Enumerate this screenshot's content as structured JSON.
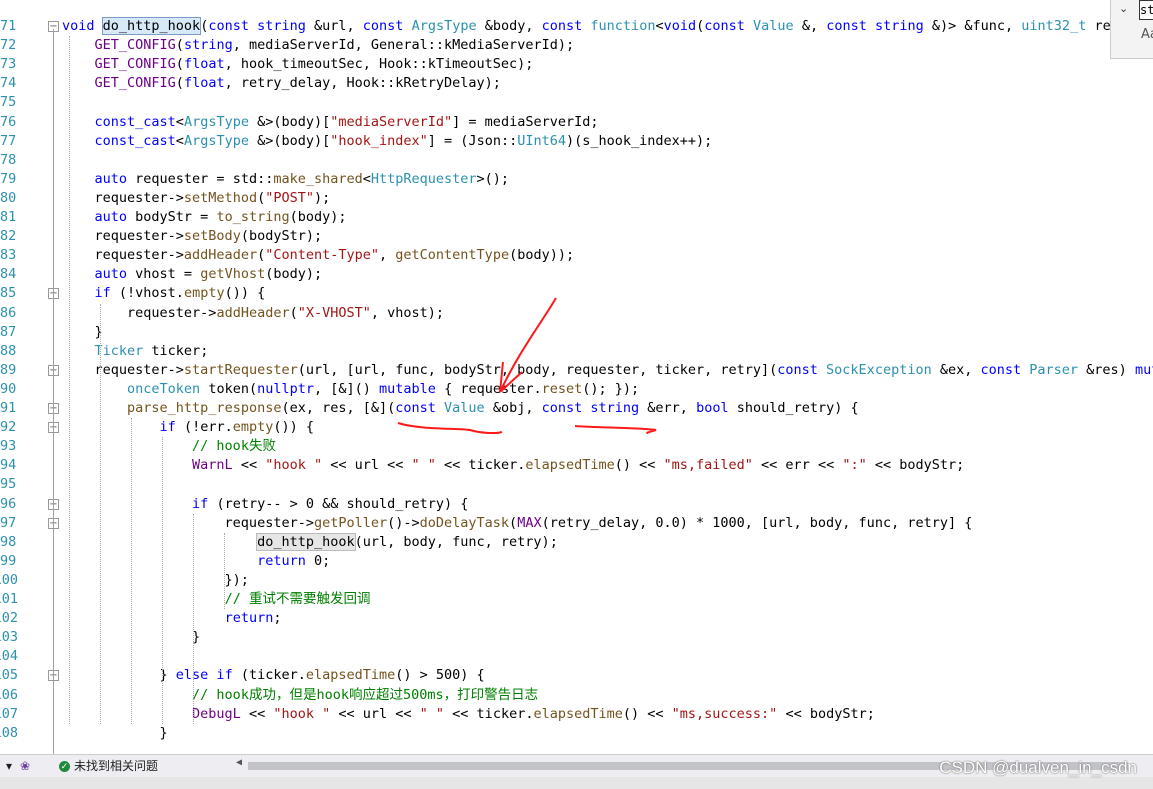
{
  "find": {
    "chevron": "⌄",
    "value": "st",
    "match_case": "Aa"
  },
  "lines": [
    {
      "n": "71",
      "fold": "minus",
      "segs": [
        [
          "kw",
          "void "
        ],
        [
          "hl",
          "do_http_hook"
        ],
        [
          "",
          "("
        ],
        [
          "kw",
          "const "
        ],
        [
          "kw",
          "string "
        ],
        [
          "",
          "&url, "
        ],
        [
          "kw",
          "const "
        ],
        [
          "ty",
          "ArgsType "
        ],
        [
          "",
          "&body, "
        ],
        [
          "kw",
          "const "
        ],
        [
          "ty",
          "function"
        ],
        [
          "",
          "<"
        ],
        [
          "kw",
          "void"
        ],
        [
          "",
          "("
        ],
        [
          "kw",
          "const "
        ],
        [
          "ty",
          "Value "
        ],
        [
          "",
          "&, "
        ],
        [
          "kw",
          "const "
        ],
        [
          "kw",
          "string "
        ],
        [
          "",
          "&)> &func, "
        ],
        [
          "ty",
          "uint32_t "
        ],
        [
          "",
          "retry)"
        ]
      ]
    },
    {
      "n": "72",
      "segs": [
        [
          "",
          "    "
        ],
        [
          "mc",
          "GET_CONFIG"
        ],
        [
          "",
          "("
        ],
        [
          "kw",
          "string"
        ],
        [
          "",
          ", mediaServerId, General::kMediaServerId);"
        ]
      ]
    },
    {
      "n": "73",
      "segs": [
        [
          "",
          "    "
        ],
        [
          "mc",
          "GET_CONFIG"
        ],
        [
          "",
          "("
        ],
        [
          "kw",
          "float"
        ],
        [
          "",
          ", hook_timeoutSec, Hook::kTimeoutSec);"
        ]
      ]
    },
    {
      "n": "74",
      "segs": [
        [
          "",
          "    "
        ],
        [
          "mc",
          "GET_CONFIG"
        ],
        [
          "",
          "("
        ],
        [
          "kw",
          "float"
        ],
        [
          "",
          ", retry_delay, Hook::kRetryDelay);"
        ]
      ]
    },
    {
      "n": "75",
      "segs": []
    },
    {
      "n": "76",
      "segs": [
        [
          "",
          "    "
        ],
        [
          "kw",
          "const_cast"
        ],
        [
          "",
          "<"
        ],
        [
          "ty",
          "ArgsType "
        ],
        [
          "",
          "&>(body)["
        ],
        [
          "st",
          "\"mediaServerId\""
        ],
        [
          "",
          "] = mediaServerId;"
        ]
      ]
    },
    {
      "n": "77",
      "segs": [
        [
          "",
          "    "
        ],
        [
          "kw",
          "const_cast"
        ],
        [
          "",
          "<"
        ],
        [
          "ty",
          "ArgsType "
        ],
        [
          "",
          "&>(body)["
        ],
        [
          "st",
          "\"hook_index\""
        ],
        [
          "",
          "] = (Json::"
        ],
        [
          "ty",
          "UInt64"
        ],
        [
          "",
          ")(s_hook_index++);"
        ]
      ]
    },
    {
      "n": "78",
      "segs": []
    },
    {
      "n": "79",
      "segs": [
        [
          "",
          "    "
        ],
        [
          "kw",
          "auto "
        ],
        [
          "",
          "requester = std::"
        ],
        [
          "fn",
          "make_shared"
        ],
        [
          "",
          "<"
        ],
        [
          "ty",
          "HttpRequester"
        ],
        [
          "",
          ">();"
        ]
      ]
    },
    {
      "n": "80",
      "segs": [
        [
          "",
          "    requester->"
        ],
        [
          "fn",
          "setMethod"
        ],
        [
          "",
          "("
        ],
        [
          "st",
          "\"POST\""
        ],
        [
          "",
          ");"
        ]
      ]
    },
    {
      "n": "81",
      "segs": [
        [
          "",
          "    "
        ],
        [
          "kw",
          "auto "
        ],
        [
          "",
          "bodyStr = "
        ],
        [
          "fn",
          "to_string"
        ],
        [
          "",
          "(body);"
        ]
      ]
    },
    {
      "n": "82",
      "segs": [
        [
          "",
          "    requester->"
        ],
        [
          "fn",
          "setBody"
        ],
        [
          "",
          "(bodyStr);"
        ]
      ]
    },
    {
      "n": "83",
      "segs": [
        [
          "",
          "    requester->"
        ],
        [
          "fn",
          "addHeader"
        ],
        [
          "",
          "("
        ],
        [
          "st",
          "\"Content-Type\""
        ],
        [
          "",
          ", "
        ],
        [
          "fn",
          "getContentType"
        ],
        [
          "",
          "(body));"
        ]
      ]
    },
    {
      "n": "84",
      "segs": [
        [
          "",
          "    "
        ],
        [
          "kw",
          "auto "
        ],
        [
          "",
          "vhost = "
        ],
        [
          "fn",
          "getVhost"
        ],
        [
          "",
          "(body);"
        ]
      ]
    },
    {
      "n": "85",
      "fold": "minus",
      "segs": [
        [
          "",
          "    "
        ],
        [
          "kw",
          "if "
        ],
        [
          "",
          "(!vhost."
        ],
        [
          "fn",
          "empty"
        ],
        [
          "",
          "()) {"
        ]
      ]
    },
    {
      "n": "86",
      "segs": [
        [
          "",
          "        requester->"
        ],
        [
          "fn",
          "addHeader"
        ],
        [
          "",
          "("
        ],
        [
          "st",
          "\"X-VHOST\""
        ],
        [
          "",
          ", vhost);"
        ]
      ]
    },
    {
      "n": "87",
      "segs": [
        [
          "",
          "    }"
        ]
      ]
    },
    {
      "n": "88",
      "segs": [
        [
          "",
          "    "
        ],
        [
          "ty",
          "Ticker "
        ],
        [
          "",
          "ticker;"
        ]
      ]
    },
    {
      "n": "89",
      "fold": "minus",
      "segs": [
        [
          "",
          "    requester->"
        ],
        [
          "fn",
          "startRequester"
        ],
        [
          "",
          "(url, [url, func, bodyStr, body, requester, ticker, retry]("
        ],
        [
          "kw",
          "const "
        ],
        [
          "ty",
          "SockException "
        ],
        [
          "",
          "&ex, "
        ],
        [
          "kw",
          "const "
        ],
        [
          "ty",
          "Parser "
        ],
        [
          "",
          "&res) "
        ],
        [
          "kw",
          "mutable "
        ],
        [
          "",
          "{"
        ]
      ]
    },
    {
      "n": "90",
      "segs": [
        [
          "",
          "        "
        ],
        [
          "ty",
          "onceToken "
        ],
        [
          "",
          "token("
        ],
        [
          "kw",
          "nullptr"
        ],
        [
          "",
          ", [&]() "
        ],
        [
          "kw",
          "mutable "
        ],
        [
          "",
          "{ requester."
        ],
        [
          "fn",
          "reset"
        ],
        [
          "",
          "(); });"
        ]
      ]
    },
    {
      "n": "91",
      "fold": "minus",
      "segs": [
        [
          "",
          "        "
        ],
        [
          "fn",
          "parse_http_response"
        ],
        [
          "",
          "(ex, res, [&]("
        ],
        [
          "kw",
          "const "
        ],
        [
          "ty",
          "Value "
        ],
        [
          "",
          "&obj, "
        ],
        [
          "kw",
          "const "
        ],
        [
          "kw",
          "string "
        ],
        [
          "",
          "&err, "
        ],
        [
          "kw",
          "bool "
        ],
        [
          "",
          "should_retry) {"
        ]
      ]
    },
    {
      "n": "92",
      "fold": "minus",
      "segs": [
        [
          "",
          "            "
        ],
        [
          "kw",
          "if "
        ],
        [
          "",
          "(!err."
        ],
        [
          "fn",
          "empty"
        ],
        [
          "",
          "()) {"
        ]
      ]
    },
    {
      "n": "93",
      "segs": [
        [
          "",
          "                "
        ],
        [
          "cm",
          "// hook失败"
        ]
      ]
    },
    {
      "n": "94",
      "segs": [
        [
          "",
          "                "
        ],
        [
          "mc",
          "WarnL "
        ],
        [
          "",
          "<< "
        ],
        [
          "st",
          "\"hook \""
        ],
        [
          "s",
          " << url << "
        ],
        [
          "st",
          "\" \""
        ],
        [
          "",
          " << ticker."
        ],
        [
          "fn",
          "elapsedTime"
        ],
        [
          "",
          "() << "
        ],
        [
          "st",
          "\"ms,failed\""
        ],
        [
          "",
          " << err << "
        ],
        [
          "st",
          "\":\""
        ],
        [
          "",
          " << bodyStr;"
        ]
      ]
    },
    {
      "n": "95",
      "segs": []
    },
    {
      "n": "96",
      "fold": "minus",
      "segs": [
        [
          "",
          "                "
        ],
        [
          "kw",
          "if "
        ],
        [
          "",
          "(retry-- > 0 && should_retry) {"
        ]
      ]
    },
    {
      "n": "97",
      "fold": "minus",
      "segs": [
        [
          "",
          "                    requester->"
        ],
        [
          "fn",
          "getPoller"
        ],
        [
          "",
          "()->"
        ],
        [
          "fn",
          "doDelayTask"
        ],
        [
          "",
          "("
        ],
        [
          "mc",
          "MAX"
        ],
        [
          "",
          "(retry_delay, 0.0) * 1000, [url, body, func, retry] {"
        ]
      ]
    },
    {
      "n": "98",
      "segs": [
        [
          "",
          "                        "
        ],
        [
          "hl2",
          "do_http_hook"
        ],
        [
          "",
          "(url, body, func, retry);"
        ]
      ]
    },
    {
      "n": "99",
      "segs": [
        [
          "",
          "                        "
        ],
        [
          "kw",
          "return "
        ],
        [
          "",
          "0;"
        ]
      ]
    },
    {
      "n": "100",
      "segs": [
        [
          "",
          "                    });"
        ]
      ]
    },
    {
      "n": "101",
      "segs": [
        [
          "",
          "                    "
        ],
        [
          "cm",
          "// 重试不需要触发回调"
        ]
      ]
    },
    {
      "n": "102",
      "segs": [
        [
          "",
          "                    "
        ],
        [
          "kw",
          "return"
        ],
        [
          "",
          ";"
        ]
      ]
    },
    {
      "n": "103",
      "segs": [
        [
          "",
          "                }"
        ]
      ]
    },
    {
      "n": "104",
      "segs": []
    },
    {
      "n": "105",
      "fold": "minus",
      "segs": [
        [
          "",
          "            } "
        ],
        [
          "kw",
          "else if "
        ],
        [
          "",
          "(ticker."
        ],
        [
          "fn",
          "elapsedTime"
        ],
        [
          "",
          "() > 500) {"
        ]
      ]
    },
    {
      "n": "106",
      "segs": [
        [
          "",
          "                "
        ],
        [
          "cm",
          "// hook成功，但是hook响应超过500ms，打印警告日志"
        ]
      ]
    },
    {
      "n": "107",
      "segs": [
        [
          "",
          "                "
        ],
        [
          "mc",
          "DebugL "
        ],
        [
          "",
          "<< "
        ],
        [
          "st",
          "\"hook \""
        ],
        [
          "",
          " << url << "
        ],
        [
          "st",
          "\" \""
        ],
        [
          "",
          " << ticker."
        ],
        [
          "fn",
          "elapsedTime"
        ],
        [
          "",
          "() << "
        ],
        [
          "st",
          "\"ms,success:\""
        ],
        [
          "",
          " << bodyStr;"
        ]
      ]
    },
    {
      "n": "108",
      "segs": [
        [
          "",
          "            }"
        ]
      ]
    }
  ],
  "status": {
    "zoom_icon": "▾",
    "issues_text": "未找到相关问题"
  },
  "watermark": "CSDN @dualven_in_csdn"
}
